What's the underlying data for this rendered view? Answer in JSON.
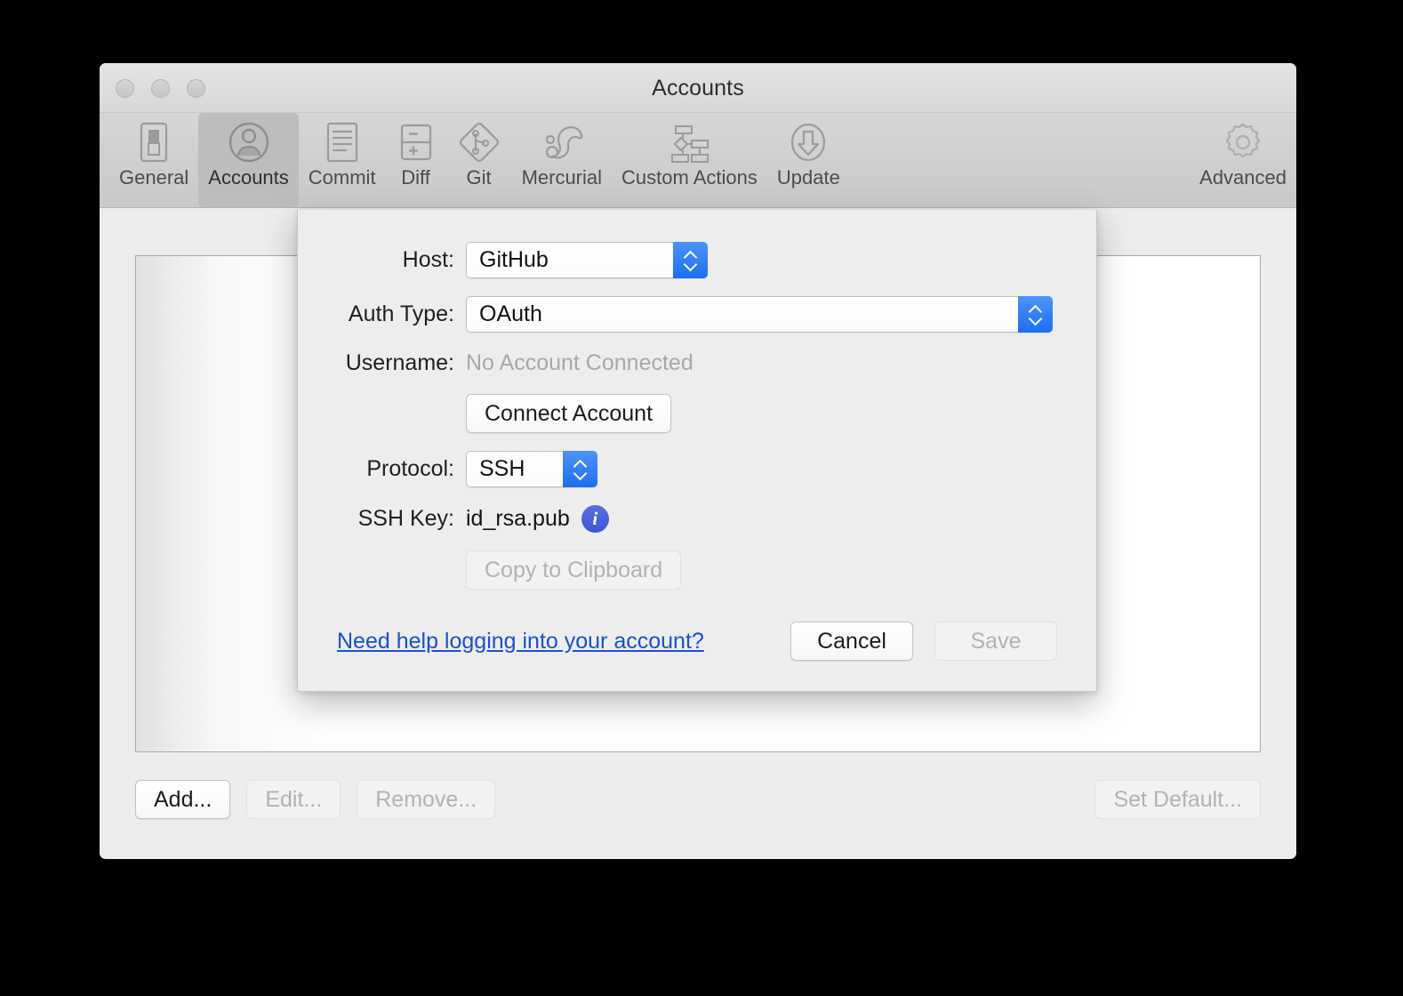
{
  "window": {
    "title": "Accounts",
    "traffic_lights": [
      "close",
      "minimize",
      "zoom"
    ]
  },
  "toolbar": {
    "items": [
      {
        "label": "General",
        "icon": "toggle-switch-icon",
        "selected": false
      },
      {
        "label": "Accounts",
        "icon": "person-circle-icon",
        "selected": true
      },
      {
        "label": "Commit",
        "icon": "document-lines-icon",
        "selected": false
      },
      {
        "label": "Diff",
        "icon": "diff-plus-minus-icon",
        "selected": false
      },
      {
        "label": "Git",
        "icon": "git-diamond-icon",
        "selected": false
      },
      {
        "label": "Mercurial",
        "icon": "mercurial-icon",
        "selected": false
      },
      {
        "label": "Custom Actions",
        "icon": "flowchart-icon",
        "selected": false
      },
      {
        "label": "Update",
        "icon": "download-arrow-icon",
        "selected": false
      }
    ],
    "trailing": {
      "label": "Advanced",
      "icon": "gear-icon",
      "selected": false
    }
  },
  "bottom_bar": {
    "add_label": "Add...",
    "edit_label": "Edit...",
    "remove_label": "Remove...",
    "set_default_label": "Set Default..."
  },
  "sheet": {
    "host": {
      "label": "Host:",
      "value": "GitHub"
    },
    "auth_type": {
      "label": "Auth Type:",
      "value": "OAuth"
    },
    "username": {
      "label": "Username:",
      "value": "No Account Connected"
    },
    "connect_account_label": "Connect Account",
    "protocol": {
      "label": "Protocol:",
      "value": "SSH"
    },
    "ssh_key": {
      "label": "SSH Key:",
      "value": "id_rsa.pub",
      "info_icon": "i"
    },
    "copy_clipboard_label": "Copy to Clipboard",
    "help_link_label": "Need help logging into your account?",
    "cancel_label": "Cancel",
    "save_label": "Save"
  },
  "colors": {
    "accent_blue": "#1c6ef0",
    "link_blue": "#1950d2",
    "info_badge": "#3d56d4",
    "window_bg": "#ececec",
    "sheet_bg": "#ededed"
  }
}
